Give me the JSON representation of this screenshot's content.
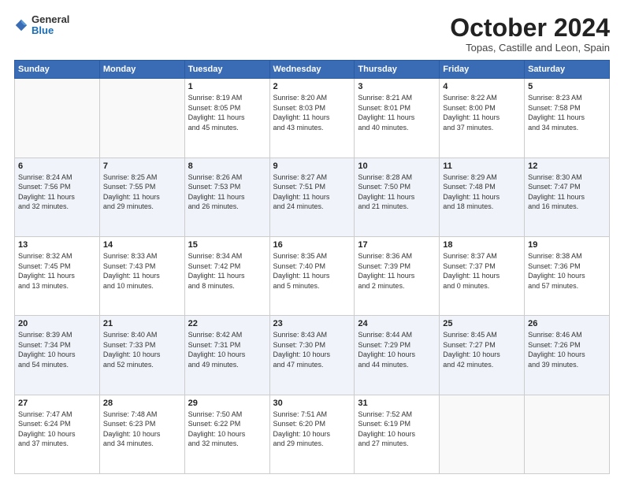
{
  "logo": {
    "general": "General",
    "blue": "Blue"
  },
  "header": {
    "month": "October 2024",
    "location": "Topas, Castille and Leon, Spain"
  },
  "weekdays": [
    "Sunday",
    "Monday",
    "Tuesday",
    "Wednesday",
    "Thursday",
    "Friday",
    "Saturday"
  ],
  "weeks": [
    [
      {
        "day": "",
        "info": ""
      },
      {
        "day": "",
        "info": ""
      },
      {
        "day": "1",
        "info": "Sunrise: 8:19 AM\nSunset: 8:05 PM\nDaylight: 11 hours\nand 45 minutes."
      },
      {
        "day": "2",
        "info": "Sunrise: 8:20 AM\nSunset: 8:03 PM\nDaylight: 11 hours\nand 43 minutes."
      },
      {
        "day": "3",
        "info": "Sunrise: 8:21 AM\nSunset: 8:01 PM\nDaylight: 11 hours\nand 40 minutes."
      },
      {
        "day": "4",
        "info": "Sunrise: 8:22 AM\nSunset: 8:00 PM\nDaylight: 11 hours\nand 37 minutes."
      },
      {
        "day": "5",
        "info": "Sunrise: 8:23 AM\nSunset: 7:58 PM\nDaylight: 11 hours\nand 34 minutes."
      }
    ],
    [
      {
        "day": "6",
        "info": "Sunrise: 8:24 AM\nSunset: 7:56 PM\nDaylight: 11 hours\nand 32 minutes."
      },
      {
        "day": "7",
        "info": "Sunrise: 8:25 AM\nSunset: 7:55 PM\nDaylight: 11 hours\nand 29 minutes."
      },
      {
        "day": "8",
        "info": "Sunrise: 8:26 AM\nSunset: 7:53 PM\nDaylight: 11 hours\nand 26 minutes."
      },
      {
        "day": "9",
        "info": "Sunrise: 8:27 AM\nSunset: 7:51 PM\nDaylight: 11 hours\nand 24 minutes."
      },
      {
        "day": "10",
        "info": "Sunrise: 8:28 AM\nSunset: 7:50 PM\nDaylight: 11 hours\nand 21 minutes."
      },
      {
        "day": "11",
        "info": "Sunrise: 8:29 AM\nSunset: 7:48 PM\nDaylight: 11 hours\nand 18 minutes."
      },
      {
        "day": "12",
        "info": "Sunrise: 8:30 AM\nSunset: 7:47 PM\nDaylight: 11 hours\nand 16 minutes."
      }
    ],
    [
      {
        "day": "13",
        "info": "Sunrise: 8:32 AM\nSunset: 7:45 PM\nDaylight: 11 hours\nand 13 minutes."
      },
      {
        "day": "14",
        "info": "Sunrise: 8:33 AM\nSunset: 7:43 PM\nDaylight: 11 hours\nand 10 minutes."
      },
      {
        "day": "15",
        "info": "Sunrise: 8:34 AM\nSunset: 7:42 PM\nDaylight: 11 hours\nand 8 minutes."
      },
      {
        "day": "16",
        "info": "Sunrise: 8:35 AM\nSunset: 7:40 PM\nDaylight: 11 hours\nand 5 minutes."
      },
      {
        "day": "17",
        "info": "Sunrise: 8:36 AM\nSunset: 7:39 PM\nDaylight: 11 hours\nand 2 minutes."
      },
      {
        "day": "18",
        "info": "Sunrise: 8:37 AM\nSunset: 7:37 PM\nDaylight: 11 hours\nand 0 minutes."
      },
      {
        "day": "19",
        "info": "Sunrise: 8:38 AM\nSunset: 7:36 PM\nDaylight: 10 hours\nand 57 minutes."
      }
    ],
    [
      {
        "day": "20",
        "info": "Sunrise: 8:39 AM\nSunset: 7:34 PM\nDaylight: 10 hours\nand 54 minutes."
      },
      {
        "day": "21",
        "info": "Sunrise: 8:40 AM\nSunset: 7:33 PM\nDaylight: 10 hours\nand 52 minutes."
      },
      {
        "day": "22",
        "info": "Sunrise: 8:42 AM\nSunset: 7:31 PM\nDaylight: 10 hours\nand 49 minutes."
      },
      {
        "day": "23",
        "info": "Sunrise: 8:43 AM\nSunset: 7:30 PM\nDaylight: 10 hours\nand 47 minutes."
      },
      {
        "day": "24",
        "info": "Sunrise: 8:44 AM\nSunset: 7:29 PM\nDaylight: 10 hours\nand 44 minutes."
      },
      {
        "day": "25",
        "info": "Sunrise: 8:45 AM\nSunset: 7:27 PM\nDaylight: 10 hours\nand 42 minutes."
      },
      {
        "day": "26",
        "info": "Sunrise: 8:46 AM\nSunset: 7:26 PM\nDaylight: 10 hours\nand 39 minutes."
      }
    ],
    [
      {
        "day": "27",
        "info": "Sunrise: 7:47 AM\nSunset: 6:24 PM\nDaylight: 10 hours\nand 37 minutes."
      },
      {
        "day": "28",
        "info": "Sunrise: 7:48 AM\nSunset: 6:23 PM\nDaylight: 10 hours\nand 34 minutes."
      },
      {
        "day": "29",
        "info": "Sunrise: 7:50 AM\nSunset: 6:22 PM\nDaylight: 10 hours\nand 32 minutes."
      },
      {
        "day": "30",
        "info": "Sunrise: 7:51 AM\nSunset: 6:20 PM\nDaylight: 10 hours\nand 29 minutes."
      },
      {
        "day": "31",
        "info": "Sunrise: 7:52 AM\nSunset: 6:19 PM\nDaylight: 10 hours\nand 27 minutes."
      },
      {
        "day": "",
        "info": ""
      },
      {
        "day": "",
        "info": ""
      }
    ]
  ]
}
